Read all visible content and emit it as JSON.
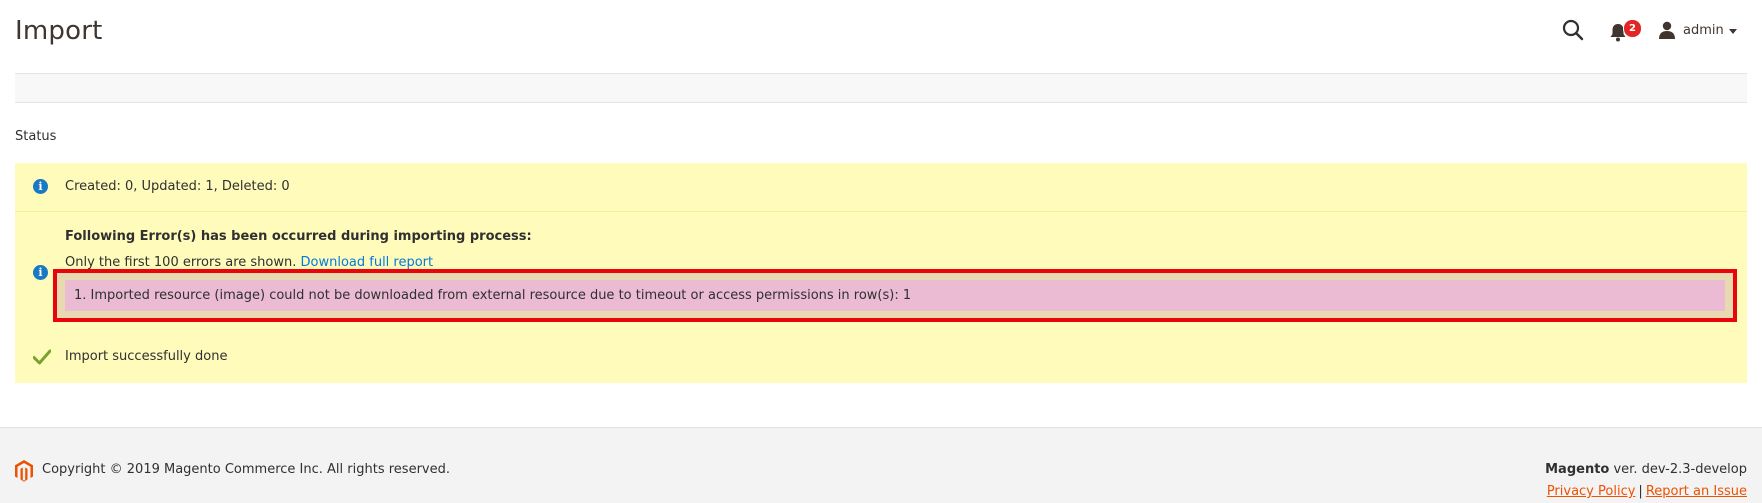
{
  "header": {
    "title": "Import",
    "notification_count": "2",
    "user_name": "admin"
  },
  "status": {
    "label": "Status"
  },
  "messages": {
    "summary": "Created: 0, Updated: 1, Deleted: 0",
    "error_heading": "Following Error(s) has been occurred during importing process:",
    "error_limit_text": "Only the first 100 errors are shown.",
    "download_link": "Download full report",
    "error_item": "1. Imported resource (image) could not be downloaded from external resource due to timeout or access permissions in row(s): 1",
    "success": "Import successfully done"
  },
  "footer": {
    "copyright": "Copyright © 2019 Magento Commerce Inc. All rights reserved.",
    "brand": "Magento",
    "version": " ver. dev-2.3-develop",
    "privacy_link": "Privacy Policy",
    "separator": "|",
    "report_link": "Report an Issue"
  },
  "colors": {
    "accent_link": "#007bdb",
    "footer_link": "#eb5202",
    "message_bg": "#fffbbb",
    "error_row_bg": "#eabbd3",
    "highlight_outline": "#e8050b",
    "notification_badge": "#e22626"
  }
}
